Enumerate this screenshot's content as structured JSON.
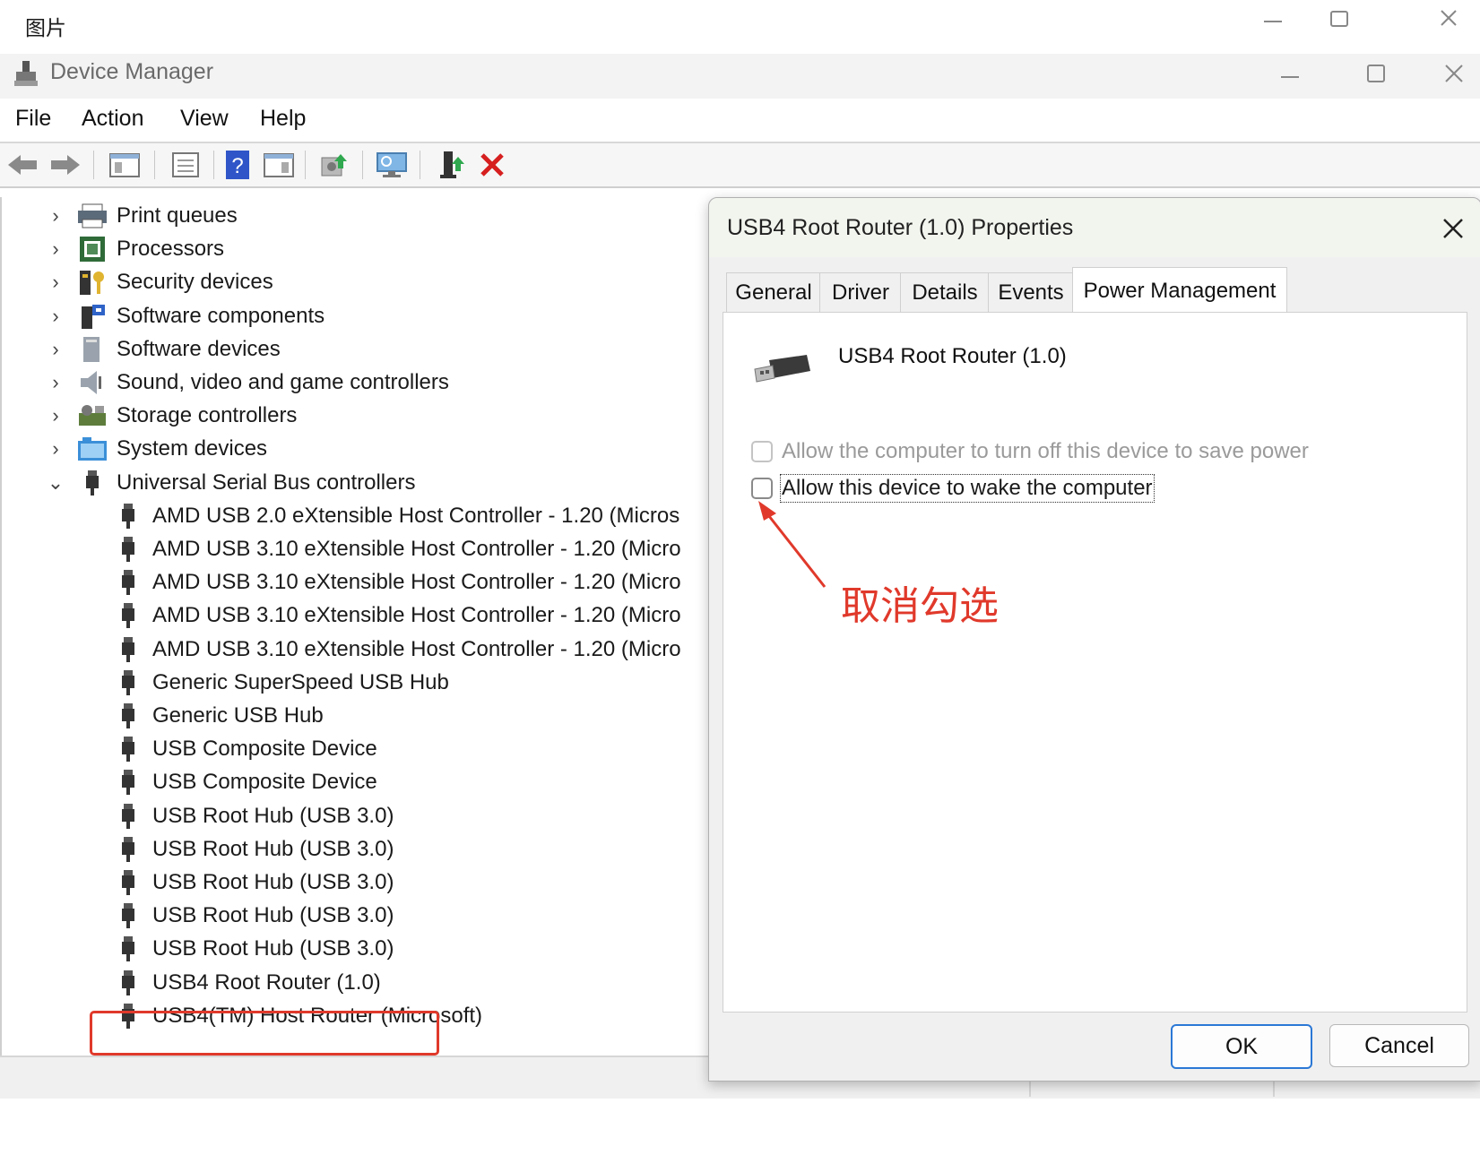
{
  "viewer": {
    "title": "图片"
  },
  "device_manager": {
    "title": "Device Manager",
    "menu": [
      "File",
      "Action",
      "View",
      "Help"
    ],
    "toolbar_icons": [
      "back-arrow-icon",
      "forward-arrow-icon",
      "show-hide-tree-icon",
      "properties-icon",
      "help-icon",
      "action-pane-icon",
      "update-driver-icon",
      "scan-hardware-icon",
      "enable-device-icon",
      "uninstall-device-icon"
    ],
    "tree": {
      "categories": [
        {
          "label": "Print queues",
          "icon": "printer-icon"
        },
        {
          "label": "Processors",
          "icon": "processor-icon"
        },
        {
          "label": "Security devices",
          "icon": "security-key-icon"
        },
        {
          "label": "Software components",
          "icon": "software-component-icon"
        },
        {
          "label": "Software devices",
          "icon": "software-device-icon"
        },
        {
          "label": "Sound, video and game controllers",
          "icon": "speaker-icon"
        },
        {
          "label": "Storage controllers",
          "icon": "storage-controller-icon"
        },
        {
          "label": "System devices",
          "icon": "system-device-icon"
        },
        {
          "label": "Universal Serial Bus controllers",
          "icon": "usb-icon"
        }
      ],
      "usb_children": [
        "AMD USB 2.0 eXtensible Host Controller - 1.20 (Micros",
        "AMD USB 3.10 eXtensible Host Controller - 1.20 (Micro",
        "AMD USB 3.10 eXtensible Host Controller - 1.20 (Micro",
        "AMD USB 3.10 eXtensible Host Controller - 1.20 (Micro",
        "AMD USB 3.10 eXtensible Host Controller - 1.20 (Micro",
        "Generic SuperSpeed USB Hub",
        "Generic USB Hub",
        "USB Composite Device",
        "USB Composite Device",
        "USB Root Hub (USB 3.0)",
        "USB Root Hub (USB 3.0)",
        "USB Root Hub (USB 3.0)",
        "USB Root Hub (USB 3.0)",
        "USB Root Hub (USB 3.0)",
        "USB4 Root Router (1.0)",
        "USB4(TM) Host Router (Microsoft)"
      ]
    }
  },
  "dialog": {
    "title": "USB4 Root Router (1.0) Properties",
    "tabs": [
      "General",
      "Driver",
      "Details",
      "Events",
      "Power Management"
    ],
    "active_tab": "Power Management",
    "device_name": "USB4 Root Router (1.0)",
    "options": [
      {
        "label": "Allow the computer to turn off this device to save power",
        "checked": false,
        "enabled": false
      },
      {
        "label": "Allow this device to wake the computer",
        "checked": false,
        "enabled": true
      }
    ],
    "ok_label": "OK",
    "cancel_label": "Cancel"
  },
  "annotation": {
    "text": "取消勾选",
    "color": "#e0392b"
  }
}
